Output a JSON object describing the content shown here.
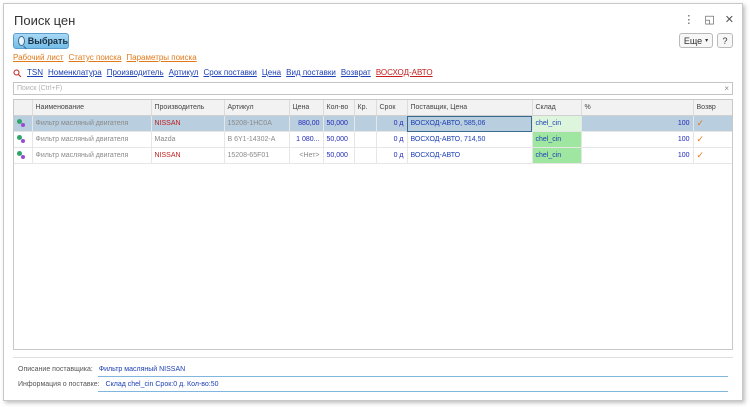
{
  "window": {
    "title": "Поиск цен",
    "controls": {
      "menu": "⋮",
      "restore": "◱",
      "close": "✕"
    }
  },
  "toolbar": {
    "select_label": "Выбрать",
    "more_label": "Еще",
    "help_label": "?"
  },
  "links": [
    "Рабочий лист",
    "Статус поиска",
    "Параметры поиска"
  ],
  "filters": {
    "items": [
      "TSN",
      "Номенклатура",
      "Производитель",
      "Артикул",
      "Срок поставки",
      "Цена",
      "Вид поставки",
      "Возврат"
    ],
    "active": "ВОСХОД-АВТО"
  },
  "search": {
    "placeholder": "Поиск (Ctrl+F)",
    "clear": "×"
  },
  "table": {
    "columns": [
      "",
      "Наименование",
      "Производитель",
      "Артикул",
      "Цена",
      "Кол-во",
      "Кр.",
      "Срок",
      "Поставщик, Цена",
      "Склад",
      "%",
      "Возвр"
    ],
    "rows": [
      {
        "name": "Фильтр масляный двигателя",
        "maker": "NISSAN",
        "maker_red": true,
        "article": "15208-1HC0A",
        "price": "880,00",
        "qty": "50,000",
        "kr": "",
        "term": "0 д",
        "supplier": "ВОСХОД-АВТО, 585,06",
        "warehouse": "chel_cin",
        "pct": "100",
        "ret": "✓"
      },
      {
        "name": "Фильтр масляный двигателя",
        "maker": "Mazda",
        "maker_red": false,
        "article": "B 6Y1-14302-A",
        "price": "1 080...",
        "qty": "50,000",
        "kr": "",
        "term": "0 д",
        "supplier": "ВОСХОД-АВТО, 714,50",
        "warehouse": "chel_cin",
        "pct": "100",
        "ret": "✓"
      },
      {
        "name": "Фильтр масляный двигателя",
        "maker": "NISSAN",
        "maker_red": true,
        "article": "15208-65F01",
        "price": "<Нет>",
        "qty": "50,000",
        "kr": "",
        "term": "0 д",
        "supplier": "ВОСХОД-АВТО",
        "warehouse": "chel_cin",
        "pct": "100",
        "ret": "✓"
      }
    ]
  },
  "footer": {
    "supplier_desc_label": "Описание поставщика:",
    "supplier_desc_value": "Фильтр масляный NISSAN",
    "delivery_info_label": "Информация о поставке:",
    "delivery_info_value": "Склад chel_cin Срок:0 д. Кол-во:50"
  }
}
